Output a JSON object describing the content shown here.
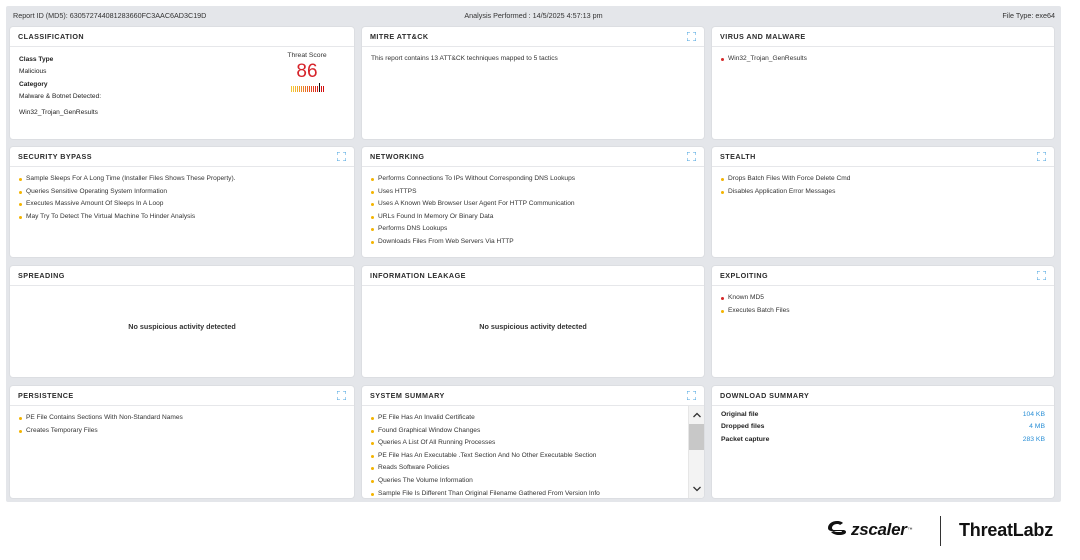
{
  "header": {
    "report_id": "Report ID (MD5): 630572744081283660FC3AAC6AD3C19D",
    "analysis": "Analysis Performed : 14/5/2025 4:57:13 pm",
    "file_type": "File Type: exe64"
  },
  "classification": {
    "title": "CLASSIFICATION",
    "class_type_label": "Class Type",
    "class_type_value": "Malicious",
    "category_label": "Category",
    "category_value": "Malware & Botnet Detected:",
    "category_detail": "Win32_Trojan_GenResults",
    "threat_score_label": "Threat Score",
    "threat_score": "86",
    "threat_color": "#d6232a"
  },
  "mitre": {
    "title": "MITRE ATT&CK",
    "text": "This report contains 13 ATT&CK techniques mapped to 5 tactics"
  },
  "virus": {
    "title": "VIRUS AND MALWARE",
    "items": [
      "Win32_Trojan_GenResults"
    ]
  },
  "security_bypass": {
    "title": "SECURITY BYPASS",
    "items": [
      "Sample Sleeps For A Long Time (Installer Files Shows These Property).",
      "Queries Sensitive Operating System Information",
      "Executes Massive Amount Of Sleeps In A Loop",
      "May Try To Detect The Virtual Machine To Hinder Analysis"
    ]
  },
  "networking": {
    "title": "NETWORKING",
    "items": [
      "Performs Connections To IPs Without Corresponding DNS Lookups",
      "Uses HTTPS",
      "Uses A Known Web Browser User Agent For HTTP Communication",
      "URLs Found In Memory Or Binary Data",
      "Performs DNS Lookups",
      "Downloads Files From Web Servers Via HTTP"
    ]
  },
  "stealth": {
    "title": "STEALTH",
    "items": [
      "Drops Batch Files With Force Delete Cmd",
      "Disables Application Error Messages"
    ]
  },
  "spreading": {
    "title": "SPREADING",
    "message": "No suspicious activity detected"
  },
  "info_leakage": {
    "title": "INFORMATION LEAKAGE",
    "message": "No suspicious activity detected"
  },
  "exploiting": {
    "title": "EXPLOITING",
    "items": [
      "Known MD5",
      "Executes Batch Files"
    ]
  },
  "persistence": {
    "title": "PERSISTENCE",
    "items": [
      "PE File Contains Sections With Non-Standard Names",
      "Creates Temporary Files"
    ]
  },
  "system_summary": {
    "title": "SYSTEM SUMMARY",
    "items": [
      "PE File Has An Invalid Certificate",
      "Found Graphical Window Changes",
      "Queries A List Of All Running Processes",
      "PE File Has An Executable .Text Section And No Other Executable Section",
      "Reads Software Policies",
      "Queries The Volume Information",
      "Sample File Is Different Than Original Filename Gathered From Version Info"
    ]
  },
  "download_summary": {
    "title": "DOWNLOAD SUMMARY",
    "rows": [
      {
        "label": "Original file",
        "value": "104 KB"
      },
      {
        "label": "Dropped files",
        "value": "4 MB"
      },
      {
        "label": "Packet capture",
        "value": "283 KB"
      }
    ]
  },
  "colors": {
    "accent_blue": "#2a8fd6",
    "bullet_yellow": "#f4b400",
    "bullet_red": "#d62828",
    "panel_bg": "#e4e6ea"
  },
  "footer": {
    "zscaler": "zscaler",
    "threatlabz": "ThreatLabz",
    "zscaler_logo_icon": "zscaler-logo-icon"
  }
}
